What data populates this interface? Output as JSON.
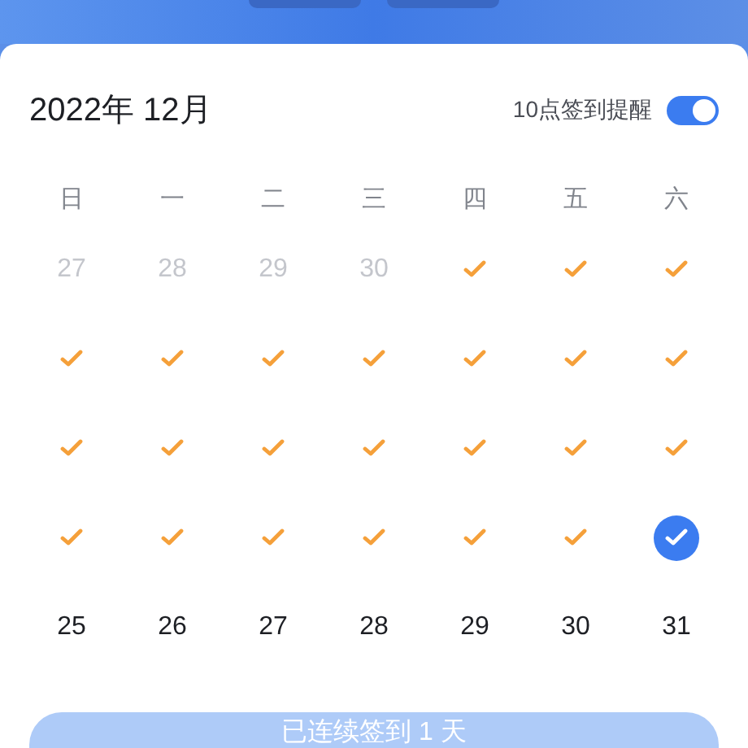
{
  "header": {
    "pills": [
      {
        "kind": "pill"
      },
      {
        "kind": "pill"
      }
    ]
  },
  "title": "2022年 12月",
  "reminder": {
    "label": "10点签到提醒",
    "on": true
  },
  "weekdays": [
    "日",
    "一",
    "二",
    "三",
    "四",
    "五",
    "六"
  ],
  "weeks": [
    [
      {
        "kind": "faded",
        "label": "27"
      },
      {
        "kind": "faded",
        "label": "28"
      },
      {
        "kind": "faded",
        "label": "29"
      },
      {
        "kind": "faded",
        "label": "30"
      },
      {
        "kind": "checked"
      },
      {
        "kind": "checked"
      },
      {
        "kind": "checked"
      }
    ],
    [
      {
        "kind": "checked"
      },
      {
        "kind": "checked"
      },
      {
        "kind": "checked"
      },
      {
        "kind": "checked"
      },
      {
        "kind": "checked"
      },
      {
        "kind": "checked"
      },
      {
        "kind": "checked"
      }
    ],
    [
      {
        "kind": "checked"
      },
      {
        "kind": "checked"
      },
      {
        "kind": "checked"
      },
      {
        "kind": "checked"
      },
      {
        "kind": "checked"
      },
      {
        "kind": "checked"
      },
      {
        "kind": "checked"
      }
    ],
    [
      {
        "kind": "checked"
      },
      {
        "kind": "checked"
      },
      {
        "kind": "checked"
      },
      {
        "kind": "checked"
      },
      {
        "kind": "checked"
      },
      {
        "kind": "checked"
      },
      {
        "kind": "today"
      }
    ],
    [
      {
        "kind": "day",
        "label": "25"
      },
      {
        "kind": "day",
        "label": "26"
      },
      {
        "kind": "day",
        "label": "27"
      },
      {
        "kind": "day",
        "label": "28"
      },
      {
        "kind": "day",
        "label": "29"
      },
      {
        "kind": "day",
        "label": "30"
      },
      {
        "kind": "day",
        "label": "31"
      }
    ]
  ],
  "button": "已连续签到 1 天"
}
